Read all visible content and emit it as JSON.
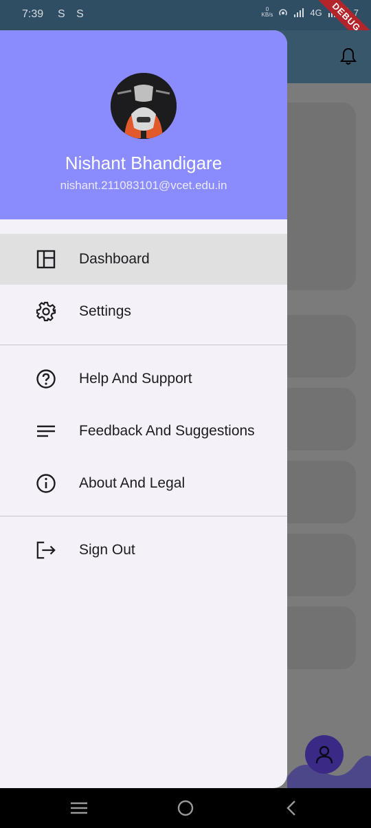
{
  "status_bar": {
    "time": "7:39",
    "sim_icons": "S S",
    "kb_value": "0",
    "kb_unit": "KB/s",
    "network": "4G",
    "battery": "7",
    "debug_label": "DEBUG"
  },
  "drawer": {
    "user": {
      "name": "Nishant Bhandigare",
      "email": "nishant.211083101@vcet.edu.in"
    },
    "menu_groups": [
      [
        {
          "label": "Dashboard",
          "icon": "dashboard-icon",
          "active": true
        },
        {
          "label": "Settings",
          "icon": "gear-icon",
          "active": false
        }
      ],
      [
        {
          "label": "Help And Support",
          "icon": "help-circle-icon",
          "active": false
        },
        {
          "label": "Feedback And Suggestions",
          "icon": "lines-icon",
          "active": false
        },
        {
          "label": "About And Legal",
          "icon": "info-icon",
          "active": false
        }
      ],
      [
        {
          "label": "Sign Out",
          "icon": "logout-icon",
          "active": false
        }
      ]
    ]
  },
  "colors": {
    "drawer_header": "#8a8cfd",
    "drawer_bg": "#f5f1f8",
    "active_item": "#e0e0e0",
    "fab": "#3a2a86"
  }
}
